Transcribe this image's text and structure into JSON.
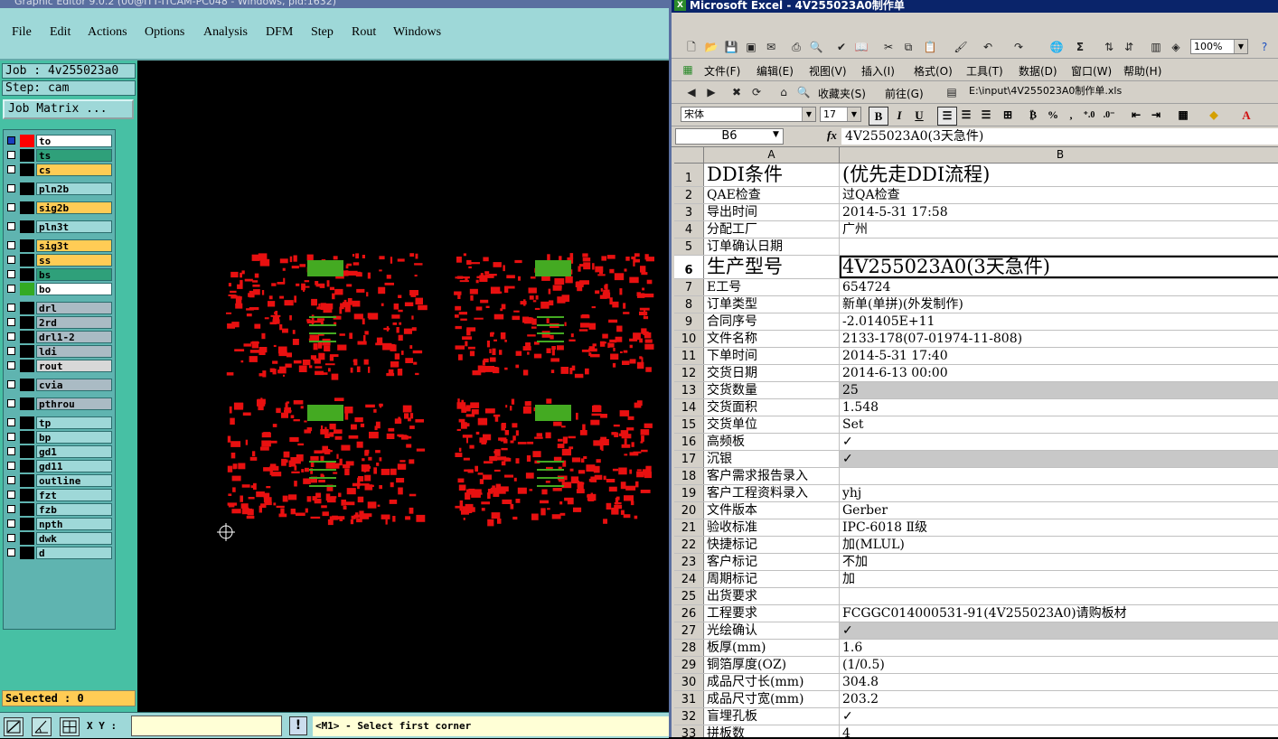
{
  "editor": {
    "title": "Graphic Editor 9.0.2 (00@ITT-ITCAM-PC048 - Windows, pid:1632)",
    "menu": [
      {
        "label": "File",
        "u": "F"
      },
      {
        "label": "Edit",
        "u": "E"
      },
      {
        "label": "Actions",
        "u": "A"
      },
      {
        "label": "Options",
        "u": "O"
      },
      {
        "label": "Analysis",
        "u": "A"
      },
      {
        "label": "DFM",
        "u": "D"
      },
      {
        "label": "Step",
        "u": "S"
      },
      {
        "label": "Rout",
        "u": "R"
      },
      {
        "label": "Windows",
        "u": "W"
      }
    ],
    "job": "Job : 4v255023a0",
    "step": "Step: cam",
    "job_matrix": "Job Matrix ...",
    "layers": [
      {
        "name": "to",
        "bg": "#ffffff",
        "swatch": "#ff0000",
        "checked": true
      },
      {
        "name": "ts",
        "bg": "#2fa07a",
        "swatch": "#000000"
      },
      {
        "name": "cs",
        "bg": "#ffcc55",
        "swatch": "#000000"
      },
      {
        "name": "pln2b",
        "bg": "#9ed8d8",
        "swatch": "#000000",
        "gap": true
      },
      {
        "name": "sig2b",
        "bg": "#ffcc55",
        "swatch": "#000000",
        "gap": true
      },
      {
        "name": "pln3t",
        "bg": "#9ed8d8",
        "swatch": "#000000",
        "gap": true
      },
      {
        "name": "sig3t",
        "bg": "#ffcc55",
        "swatch": "#000000",
        "gap": true
      },
      {
        "name": "ss",
        "bg": "#ffcc55",
        "swatch": "#000000"
      },
      {
        "name": "bs",
        "bg": "#2fa07a",
        "swatch": "#000000"
      },
      {
        "name": "bo",
        "bg": "#ffffff",
        "swatch": "#33aa22"
      },
      {
        "name": "drl",
        "bg": "#aabbc4",
        "swatch": "#000000",
        "gap": true
      },
      {
        "name": "2rd",
        "bg": "#aabbc4",
        "swatch": "#000000"
      },
      {
        "name": "drl1-2",
        "bg": "#aabbc4",
        "swatch": "#000000"
      },
      {
        "name": "ldi",
        "bg": "#aabbc4",
        "swatch": "#000000"
      },
      {
        "name": "rout",
        "bg": "#d8d8d8",
        "swatch": "#000000"
      },
      {
        "name": "cvia",
        "bg": "#aabbc4",
        "swatch": "#000000",
        "gap": true
      },
      {
        "name": "pthrou",
        "bg": "#aabbc4",
        "swatch": "#000000",
        "gap": true
      },
      {
        "name": "tp",
        "bg": "#9ed8d8",
        "swatch": "#000000",
        "gap": true
      },
      {
        "name": "bp",
        "bg": "#9ed8d8",
        "swatch": "#000000"
      },
      {
        "name": "gd1",
        "bg": "#9ed8d8",
        "swatch": "#000000"
      },
      {
        "name": "gd11",
        "bg": "#9ed8d8",
        "swatch": "#000000"
      },
      {
        "name": "outline",
        "bg": "#9ed8d8",
        "swatch": "#000000"
      },
      {
        "name": "fzt",
        "bg": "#9ed8d8",
        "swatch": "#000000"
      },
      {
        "name": "fzb",
        "bg": "#9ed8d8",
        "swatch": "#000000"
      },
      {
        "name": "npth",
        "bg": "#9ed8d8",
        "swatch": "#000000"
      },
      {
        "name": "dwk",
        "bg": "#9ed8d8",
        "swatch": "#000000"
      },
      {
        "name": "d",
        "bg": "#9ed8d8",
        "swatch": "#000000"
      }
    ],
    "selected": "Selected : 0",
    "xy_label": "X Y :",
    "xy_value": "",
    "message": "<M1> - Select first corner",
    "colors": {
      "pcb_red": "#e81010",
      "pcb_green": "#44aa22",
      "background": "#000000"
    }
  },
  "excel": {
    "title": "Microsoft Excel - 4V255023A0制作单",
    "menu": [
      "文件(F)",
      "编辑(E)",
      "视图(V)",
      "插入(I)",
      "格式(O)",
      "工具(T)",
      "数据(D)",
      "窗口(W)",
      "帮助(H)"
    ],
    "zoom": "100%",
    "favorites": "收藏夹(S)",
    "goto": "前往(G)",
    "path": "E:\\input\\4V255023A0制作单.xls",
    "font_name": "宋体",
    "font_size": "17",
    "name_box": "B6",
    "formula": "4V255023A0(3天急件)",
    "columns": [
      "A",
      "B"
    ],
    "rows": [
      {
        "n": "1",
        "a": "DDI条件",
        "b": "(优先走DDI流程)",
        "big": true
      },
      {
        "n": "2",
        "a": "QAE检查",
        "b": "过QA检查"
      },
      {
        "n": "3",
        "a": "导出时间",
        "b": "2014-5-31 17:58"
      },
      {
        "n": "4",
        "a": "分配工厂",
        "b": "广州"
      },
      {
        "n": "5",
        "a": "订单确认日期",
        "b": ""
      },
      {
        "n": "6",
        "a": "生产型号",
        "b": "4V255023A0(3天急件)",
        "big": true,
        "sel": true
      },
      {
        "n": "7",
        "a": "E工号",
        "b": "654724"
      },
      {
        "n": "8",
        "a": "订单类型",
        "b": "新单(单拼)(外发制作)"
      },
      {
        "n": "9",
        "a": "合同序号",
        "b": "-2.01405E+11"
      },
      {
        "n": "10",
        "a": "文件名称",
        "b": "2133-178(07-01974-11-808)"
      },
      {
        "n": "11",
        "a": "下单时间",
        "b": "2014-5-31 17:40"
      },
      {
        "n": "12",
        "a": "交货日期",
        "b": "2014-6-13 00:00"
      },
      {
        "n": "13",
        "a": "交货数量",
        "b": "25",
        "shade": true
      },
      {
        "n": "14",
        "a": "交货面积",
        "b": "1.548"
      },
      {
        "n": "15",
        "a": "交货单位",
        "b": "Set"
      },
      {
        "n": "16",
        "a": "高频板",
        "b": "✓"
      },
      {
        "n": "17",
        "a": "沉银",
        "b": "✓",
        "shade": true
      },
      {
        "n": "18",
        "a": "客户需求报告录入",
        "b": ""
      },
      {
        "n": "19",
        "a": "客户工程资料录入",
        "b": "yhj"
      },
      {
        "n": "20",
        "a": "文件版本",
        "b": "Gerber"
      },
      {
        "n": "21",
        "a": "验收标准",
        "b": "IPC-6018 Ⅱ级"
      },
      {
        "n": "22",
        "a": "快捷标记",
        "b": "加(MLUL)"
      },
      {
        "n": "23",
        "a": "客户标记",
        "b": "不加"
      },
      {
        "n": "24",
        "a": "周期标记",
        "b": "加"
      },
      {
        "n": "25",
        "a": "出货要求",
        "b": ""
      },
      {
        "n": "26",
        "a": "工程要求",
        "b": "FCGGC014000531-91(4V255023A0)请购板材"
      },
      {
        "n": "27",
        "a": "光绘确认",
        "b": "✓",
        "shade": true
      },
      {
        "n": "28",
        "a": "板厚(mm)",
        "b": "1.6"
      },
      {
        "n": "29",
        "a": "铜箔厚度(OZ)",
        "b": "(1/0.5)"
      },
      {
        "n": "30",
        "a": "成品尺寸长(mm)",
        "b": "304.8"
      },
      {
        "n": "31",
        "a": "成品尺寸宽(mm)",
        "b": "203.2"
      },
      {
        "n": "32",
        "a": "盲埋孔板",
        "b": "✓"
      },
      {
        "n": "33",
        "a": "拼板数",
        "b": "4"
      }
    ]
  }
}
